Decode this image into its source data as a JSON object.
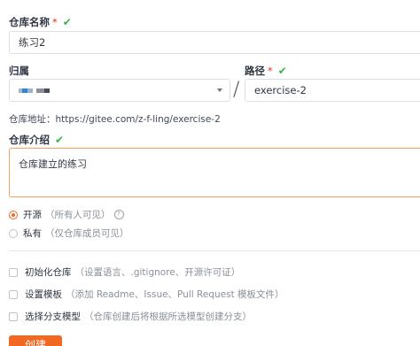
{
  "repo_name": {
    "label": "仓库名称",
    "required_mark": "*",
    "valid_mark": "✔",
    "value": "练习2"
  },
  "owner": {
    "label": "归属",
    "blocks": [
      {
        "color": "#a9b6c6",
        "w": 4
      },
      {
        "color": "#2e86d9",
        "w": 6
      },
      {
        "color": "#9fb3c8",
        "w": 6
      },
      {
        "color": "#ffffff",
        "w": 4
      },
      {
        "color": "#8a8f99",
        "w": 9
      },
      {
        "color": "#474d59",
        "w": 6
      }
    ]
  },
  "separator": "/",
  "path": {
    "label": "路径",
    "required_mark": "*",
    "valid_mark": "✔",
    "value": "exercise-2"
  },
  "repo_address": "仓库地址：https://gitee.com/z-f-ling/exercise-2",
  "description": {
    "label": "仓库介绍",
    "valid_mark": "✔",
    "value": "仓库建立的练习"
  },
  "visibility": {
    "options": [
      {
        "label": "开源",
        "hint": "（所有人可见）",
        "selected": true,
        "help": "?"
      },
      {
        "label": "私有",
        "hint": "（仅仓库成员可见）",
        "selected": false
      }
    ]
  },
  "options": [
    {
      "label": "初始化仓库",
      "hint": "（设置语言、.gitignore、开源许可证）"
    },
    {
      "label": "设置模板",
      "hint": "（添加 Readme、Issue、Pull Request 模板文件）"
    },
    {
      "label": "选择分支模型",
      "hint": "（仓库创建后将根据所选模型创建分支）"
    }
  ],
  "create_button": "创建",
  "colors": {
    "accent": "#f26722",
    "valid": "#3bb34a",
    "required": "#e0301e"
  }
}
